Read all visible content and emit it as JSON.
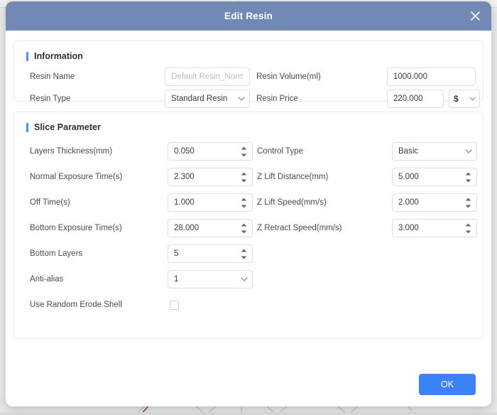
{
  "dialog": {
    "title": "Edit Resin",
    "close_icon": "close-icon"
  },
  "information": {
    "section_title": "Information",
    "fields": {
      "resin_name": {
        "label": "Resin Name",
        "value": "",
        "placeholder": "Default Resin_Normal"
      },
      "resin_type": {
        "label": "Resin Type",
        "value": "Standard Resin",
        "icon": "chevron-down-icon"
      },
      "resin_volume": {
        "label": "Resin Volume(ml)",
        "value": "1000.000"
      },
      "resin_price": {
        "label": "Resin Price",
        "value": "220.000",
        "currency": "$",
        "currency_icon": "chevron-down-icon"
      }
    }
  },
  "slice_parameter": {
    "section_title": "Slice Parameter",
    "left_fields": [
      {
        "label": "Layers Thickness(mm)",
        "value": "0.050",
        "type": "spinner"
      },
      {
        "label": "Normal Exposure Time(s)",
        "value": "2.300",
        "type": "spinner"
      },
      {
        "label": "Off Time(s)",
        "value": "1.000",
        "type": "spinner"
      },
      {
        "label": "Bottom Exposure Time(s)",
        "value": "28.000",
        "type": "spinner"
      },
      {
        "label": "Bottom Layers",
        "value": "5",
        "type": "spinner"
      },
      {
        "label": "Anti-alias",
        "value": "1",
        "type": "select"
      },
      {
        "label": "Use Random Erode Shell",
        "value": "",
        "type": "checkbox",
        "checked": false
      }
    ],
    "right_fields": [
      {
        "label": "Control Type",
        "value": "Basic",
        "type": "select"
      },
      {
        "label": "Z Lift Distance(mm)",
        "value": "5.000",
        "type": "spinner"
      },
      {
        "label": "Z Lift Speed(mm/s)",
        "value": "2.000",
        "type": "spinner"
      },
      {
        "label": "Z Retract Speed(mm/s)",
        "value": "3.000",
        "type": "spinner"
      }
    ]
  },
  "footer": {
    "ok_label": "OK"
  },
  "colors": {
    "header": "#7289b4",
    "accent": "#4a90f0",
    "primary_button": "#3b82f6",
    "border": "#dcdfe6"
  }
}
